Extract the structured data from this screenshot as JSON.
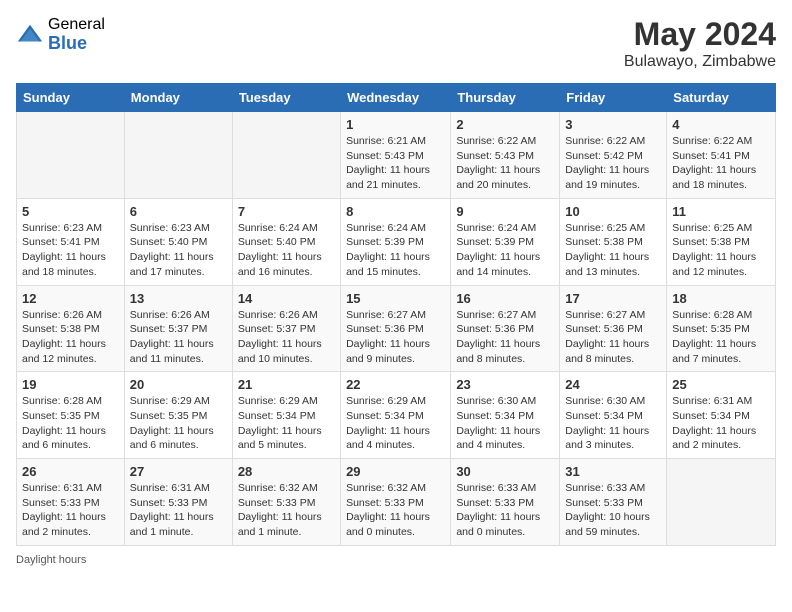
{
  "logo": {
    "general": "General",
    "blue": "Blue"
  },
  "header": {
    "month_year": "May 2024",
    "location": "Bulawayo, Zimbabwe"
  },
  "weekdays": [
    "Sunday",
    "Monday",
    "Tuesday",
    "Wednesday",
    "Thursday",
    "Friday",
    "Saturday"
  ],
  "weeks": [
    [
      {
        "day": "",
        "sunrise": "",
        "sunset": "",
        "daylight": ""
      },
      {
        "day": "",
        "sunrise": "",
        "sunset": "",
        "daylight": ""
      },
      {
        "day": "",
        "sunrise": "",
        "sunset": "",
        "daylight": ""
      },
      {
        "day": "1",
        "sunrise": "Sunrise: 6:21 AM",
        "sunset": "Sunset: 5:43 PM",
        "daylight": "Daylight: 11 hours and 21 minutes."
      },
      {
        "day": "2",
        "sunrise": "Sunrise: 6:22 AM",
        "sunset": "Sunset: 5:43 PM",
        "daylight": "Daylight: 11 hours and 20 minutes."
      },
      {
        "day": "3",
        "sunrise": "Sunrise: 6:22 AM",
        "sunset": "Sunset: 5:42 PM",
        "daylight": "Daylight: 11 hours and 19 minutes."
      },
      {
        "day": "4",
        "sunrise": "Sunrise: 6:22 AM",
        "sunset": "Sunset: 5:41 PM",
        "daylight": "Daylight: 11 hours and 18 minutes."
      }
    ],
    [
      {
        "day": "5",
        "sunrise": "Sunrise: 6:23 AM",
        "sunset": "Sunset: 5:41 PM",
        "daylight": "Daylight: 11 hours and 18 minutes."
      },
      {
        "day": "6",
        "sunrise": "Sunrise: 6:23 AM",
        "sunset": "Sunset: 5:40 PM",
        "daylight": "Daylight: 11 hours and 17 minutes."
      },
      {
        "day": "7",
        "sunrise": "Sunrise: 6:24 AM",
        "sunset": "Sunset: 5:40 PM",
        "daylight": "Daylight: 11 hours and 16 minutes."
      },
      {
        "day": "8",
        "sunrise": "Sunrise: 6:24 AM",
        "sunset": "Sunset: 5:39 PM",
        "daylight": "Daylight: 11 hours and 15 minutes."
      },
      {
        "day": "9",
        "sunrise": "Sunrise: 6:24 AM",
        "sunset": "Sunset: 5:39 PM",
        "daylight": "Daylight: 11 hours and 14 minutes."
      },
      {
        "day": "10",
        "sunrise": "Sunrise: 6:25 AM",
        "sunset": "Sunset: 5:38 PM",
        "daylight": "Daylight: 11 hours and 13 minutes."
      },
      {
        "day": "11",
        "sunrise": "Sunrise: 6:25 AM",
        "sunset": "Sunset: 5:38 PM",
        "daylight": "Daylight: 11 hours and 12 minutes."
      }
    ],
    [
      {
        "day": "12",
        "sunrise": "Sunrise: 6:26 AM",
        "sunset": "Sunset: 5:38 PM",
        "daylight": "Daylight: 11 hours and 12 minutes."
      },
      {
        "day": "13",
        "sunrise": "Sunrise: 6:26 AM",
        "sunset": "Sunset: 5:37 PM",
        "daylight": "Daylight: 11 hours and 11 minutes."
      },
      {
        "day": "14",
        "sunrise": "Sunrise: 6:26 AM",
        "sunset": "Sunset: 5:37 PM",
        "daylight": "Daylight: 11 hours and 10 minutes."
      },
      {
        "day": "15",
        "sunrise": "Sunrise: 6:27 AM",
        "sunset": "Sunset: 5:36 PM",
        "daylight": "Daylight: 11 hours and 9 minutes."
      },
      {
        "day": "16",
        "sunrise": "Sunrise: 6:27 AM",
        "sunset": "Sunset: 5:36 PM",
        "daylight": "Daylight: 11 hours and 8 minutes."
      },
      {
        "day": "17",
        "sunrise": "Sunrise: 6:27 AM",
        "sunset": "Sunset: 5:36 PM",
        "daylight": "Daylight: 11 hours and 8 minutes."
      },
      {
        "day": "18",
        "sunrise": "Sunrise: 6:28 AM",
        "sunset": "Sunset: 5:35 PM",
        "daylight": "Daylight: 11 hours and 7 minutes."
      }
    ],
    [
      {
        "day": "19",
        "sunrise": "Sunrise: 6:28 AM",
        "sunset": "Sunset: 5:35 PM",
        "daylight": "Daylight: 11 hours and 6 minutes."
      },
      {
        "day": "20",
        "sunrise": "Sunrise: 6:29 AM",
        "sunset": "Sunset: 5:35 PM",
        "daylight": "Daylight: 11 hours and 6 minutes."
      },
      {
        "day": "21",
        "sunrise": "Sunrise: 6:29 AM",
        "sunset": "Sunset: 5:34 PM",
        "daylight": "Daylight: 11 hours and 5 minutes."
      },
      {
        "day": "22",
        "sunrise": "Sunrise: 6:29 AM",
        "sunset": "Sunset: 5:34 PM",
        "daylight": "Daylight: 11 hours and 4 minutes."
      },
      {
        "day": "23",
        "sunrise": "Sunrise: 6:30 AM",
        "sunset": "Sunset: 5:34 PM",
        "daylight": "Daylight: 11 hours and 4 minutes."
      },
      {
        "day": "24",
        "sunrise": "Sunrise: 6:30 AM",
        "sunset": "Sunset: 5:34 PM",
        "daylight": "Daylight: 11 hours and 3 minutes."
      },
      {
        "day": "25",
        "sunrise": "Sunrise: 6:31 AM",
        "sunset": "Sunset: 5:34 PM",
        "daylight": "Daylight: 11 hours and 2 minutes."
      }
    ],
    [
      {
        "day": "26",
        "sunrise": "Sunrise: 6:31 AM",
        "sunset": "Sunset: 5:33 PM",
        "daylight": "Daylight: 11 hours and 2 minutes."
      },
      {
        "day": "27",
        "sunrise": "Sunrise: 6:31 AM",
        "sunset": "Sunset: 5:33 PM",
        "daylight": "Daylight: 11 hours and 1 minute."
      },
      {
        "day": "28",
        "sunrise": "Sunrise: 6:32 AM",
        "sunset": "Sunset: 5:33 PM",
        "daylight": "Daylight: 11 hours and 1 minute."
      },
      {
        "day": "29",
        "sunrise": "Sunrise: 6:32 AM",
        "sunset": "Sunset: 5:33 PM",
        "daylight": "Daylight: 11 hours and 0 minutes."
      },
      {
        "day": "30",
        "sunrise": "Sunrise: 6:33 AM",
        "sunset": "Sunset: 5:33 PM",
        "daylight": "Daylight: 11 hours and 0 minutes."
      },
      {
        "day": "31",
        "sunrise": "Sunrise: 6:33 AM",
        "sunset": "Sunset: 5:33 PM",
        "daylight": "Daylight: 10 hours and 59 minutes."
      },
      {
        "day": "",
        "sunrise": "",
        "sunset": "",
        "daylight": ""
      }
    ]
  ],
  "footer": {
    "daylight_label": "Daylight hours"
  }
}
